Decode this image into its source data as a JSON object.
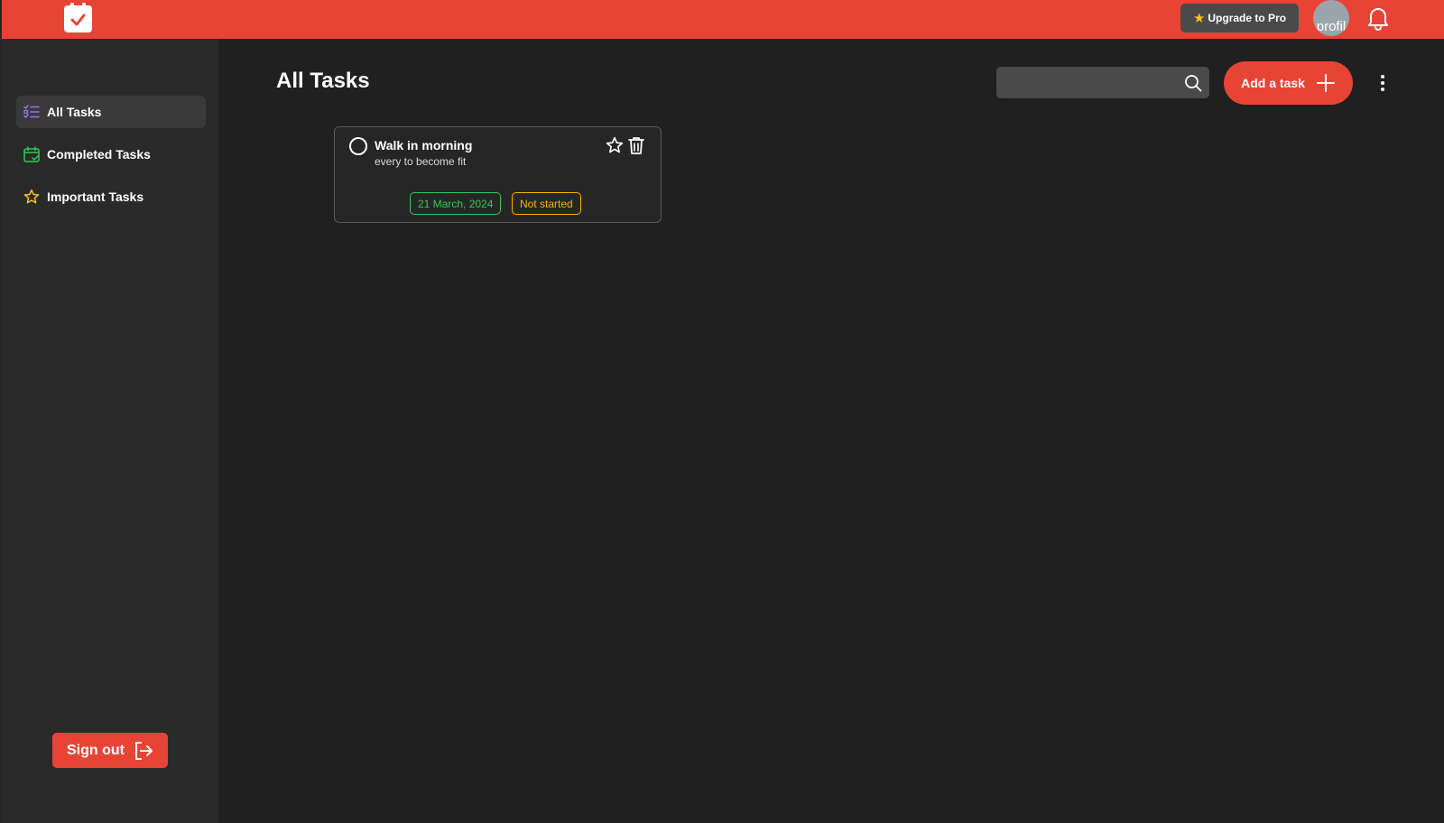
{
  "topbar": {
    "upgrade_label": "Upgrade to Pro",
    "avatar_alt_text": "profil"
  },
  "sidebar": {
    "items": [
      {
        "label": "All Tasks",
        "icon": "list-check-icon",
        "active": true
      },
      {
        "label": "Completed Tasks",
        "icon": "calendar-check-icon",
        "active": false
      },
      {
        "label": "Important Tasks",
        "icon": "star-icon",
        "active": false
      }
    ],
    "signout_label": "Sign out"
  },
  "main": {
    "title": "All Tasks",
    "search": {
      "placeholder": "",
      "value": ""
    },
    "add_task_label": "Add a task",
    "tasks": [
      {
        "title": "Walk in morning",
        "description": "every to become fit",
        "date": "21 March, 2024",
        "status": "Not started"
      }
    ]
  },
  "colors": {
    "brand": "#e84436",
    "background": "#202020",
    "sidebar": "#2a2a2a",
    "date_tag": "#34c759",
    "status_tag": "#f5b400",
    "all_tasks_icon": "#a06bff",
    "completed_icon": "#34c759",
    "important_icon": "#f5c518"
  }
}
